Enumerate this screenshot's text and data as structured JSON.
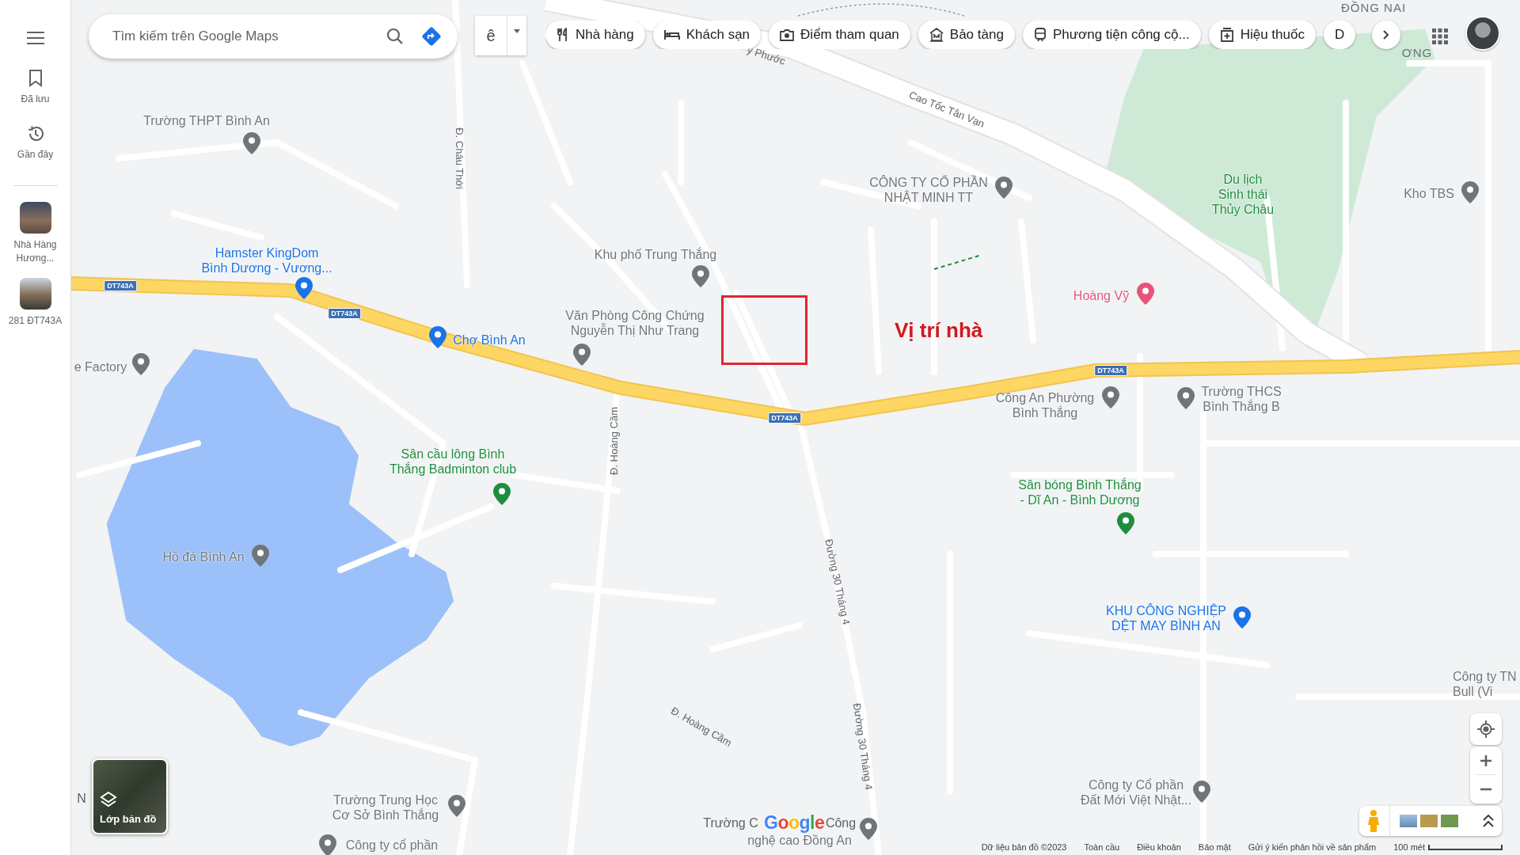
{
  "sidebar": {
    "items": [
      {
        "kind": "saved",
        "label": "Đã lưu"
      },
      {
        "kind": "recent",
        "label": "Gần đây"
      }
    ],
    "recent_places": [
      {
        "label": "Nhà Hàng Hương..."
      },
      {
        "label": "281 ĐT743A"
      }
    ]
  },
  "search": {
    "placeholder": "Tìm kiếm trên Google Maps"
  },
  "input_tool": {
    "label": "ê"
  },
  "categories": [
    {
      "kind": "restaurant",
      "label": "Nhà hàng"
    },
    {
      "kind": "hotel",
      "label": "Khách sạn"
    },
    {
      "kind": "attraction",
      "label": "Điểm tham quan"
    },
    {
      "kind": "museum",
      "label": "Bảo tàng"
    },
    {
      "kind": "transit",
      "label": "Phương tiện công cộ..."
    },
    {
      "kind": "pharmacy",
      "label": "Hiệu thuốc"
    },
    {
      "kind": "more",
      "label": "D"
    }
  ],
  "map": {
    "places": [
      {
        "kind": "poi",
        "lines": [
          "Trường THPT Bình An"
        ],
        "color": "#70757a"
      },
      {
        "kind": "poi",
        "lines": [
          "Hamster KingDom",
          "Bình Dương - Vương..."
        ],
        "color": "#1a73e8"
      },
      {
        "kind": "poi",
        "lines": [
          "Khu phố Trung Thắng"
        ],
        "color": "#70757a"
      },
      {
        "kind": "poi",
        "lines": [
          "Văn Phòng Công Chứng",
          "Nguyễn Thị Như Trang"
        ],
        "color": "#70757a"
      },
      {
        "kind": "poi",
        "lines": [
          "Chợ Bình An"
        ],
        "color": "#1a73e8"
      },
      {
        "kind": "poi",
        "lines": [
          "e Factory"
        ],
        "color": "#70757a"
      },
      {
        "kind": "poi",
        "lines": [
          "Sân cầu lông Bình",
          "Thắng Badminton club"
        ],
        "color": "#1e8e3e"
      },
      {
        "kind": "poi",
        "lines": [
          "Hồ đá Bình An"
        ],
        "color": "#70757a"
      },
      {
        "kind": "poi",
        "lines": [
          "CÔNG TY CỔ PHẦN",
          "NHẬT MINH TT"
        ],
        "color": "#70757a"
      },
      {
        "kind": "area",
        "lines": [
          "Du lịch",
          "Sinh thái",
          "Thủy Châu"
        ],
        "color": "#1e8e3e"
      },
      {
        "kind": "poi",
        "lines": [
          "Kho TBS"
        ],
        "color": "#70757a"
      },
      {
        "kind": "poi",
        "lines": [
          "Hoàng Vỹ"
        ],
        "color": "#e8537a"
      },
      {
        "kind": "poi",
        "lines": [
          "Công An Phường",
          "Bình Thắng"
        ],
        "color": "#70757a"
      },
      {
        "kind": "poi",
        "lines": [
          "Trường THCS",
          "Bình Thắng B"
        ],
        "color": "#70757a"
      },
      {
        "kind": "poi",
        "lines": [
          "Sân bóng Bình Thắng",
          "- Dĩ An - Bình Dương"
        ],
        "color": "#1e8e3e"
      },
      {
        "kind": "poi",
        "lines": [
          "KHU CÔNG NGHIỆP",
          "DỆT MAY BÌNH AN"
        ],
        "color": "#1a73e8"
      },
      {
        "kind": "area",
        "lines": [
          "Công ty TN",
          "Bull (Vi"
        ],
        "color": "#70757a"
      },
      {
        "kind": "poi",
        "lines": [
          "Công ty Cổ phần",
          "Đất Mới Việt Nhật..."
        ],
        "color": "#70757a"
      },
      {
        "kind": "poi",
        "lines": [
          "Trường Trung Học",
          "Cơ Sở Bình Thắng"
        ],
        "color": "#70757a"
      },
      {
        "kind": "poi",
        "lines": [
          "Công ty cổ phần"
        ],
        "color": "#70757a"
      },
      {
        "kind": "poi",
        "lines": [
          "nghệ cao Đồng An"
        ],
        "color": "#70757a"
      }
    ],
    "texts": [
      {
        "kind": "region",
        "text": "ĐỒNG NAI"
      },
      {
        "kind": "region",
        "text": "ƠNG"
      },
      {
        "kind": "road",
        "text": "y Phước"
      },
      {
        "kind": "road",
        "text": "Cao Tốc Tân Vạn"
      },
      {
        "kind": "road",
        "text": "Đ. Châu Thới"
      },
      {
        "kind": "road",
        "text": "Đ. Hoàng Cầm"
      },
      {
        "kind": "road",
        "text": "Đường 30 Tháng 4"
      },
      {
        "kind": "road",
        "text": "Đường 30 Tháng 4"
      },
      {
        "kind": "road",
        "text": "Đ. Hoàng Cầm"
      },
      {
        "kind": "fragment",
        "text": "Trường C"
      },
      {
        "kind": "fragment",
        "text": "Công"
      },
      {
        "kind": "fragment",
        "text": "N"
      }
    ],
    "shields": [
      "DT743A",
      "DT743A",
      "DT743A",
      "DT743A"
    ],
    "annotation": {
      "label": "Vị trí nhà"
    },
    "logo": "Google"
  },
  "layers_button": {
    "label": "Lớp bản đồ"
  },
  "footer": {
    "links": [
      "Dữ liệu bản đồ ©2023",
      "Toàn cầu",
      "Điều khoản",
      "Bảo mật",
      "Gửi ý kiến phản hồi về sản phẩm"
    ],
    "scale": "100 mét"
  }
}
